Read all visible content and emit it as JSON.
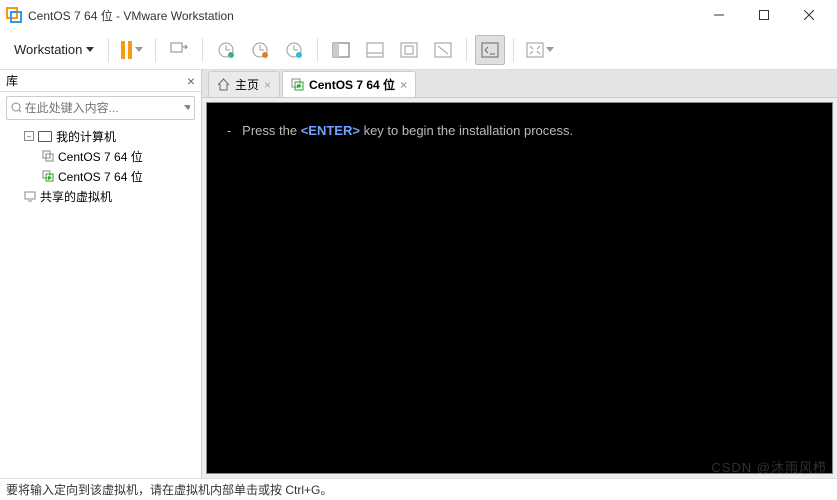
{
  "title": "CentOS 7 64 位 - VMware Workstation",
  "menu_label": "Workstation",
  "sidebar": {
    "title": "库",
    "search_placeholder": "在此处键入内容...",
    "root": "我的计算机",
    "items": [
      "CentOS 7 64 位",
      "CentOS 7 64 位"
    ],
    "shared": "共享的虚拟机"
  },
  "tabs": {
    "home": "主页",
    "vm": "CentOS 7 64 位"
  },
  "console": {
    "prefix": "-   Press the ",
    "enter": "<ENTER>",
    "suffix": " key to begin the installation process."
  },
  "status": "要将输入定向到该虚拟机，请在虚拟机内部单击或按 Ctrl+G。",
  "watermark": "CSDN @沐雨风栉"
}
